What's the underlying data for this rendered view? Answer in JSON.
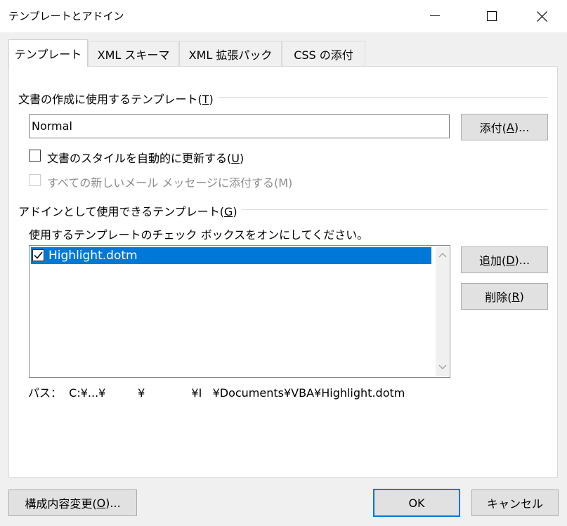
{
  "window": {
    "title": "テンプレートとアドイン"
  },
  "tabs": [
    {
      "label": "テンプレート",
      "active": true
    },
    {
      "label": "XML スキーマ",
      "active": false
    },
    {
      "label": "XML 拡張パック",
      "active": false
    },
    {
      "label": "CSS の添付",
      "active": false
    }
  ],
  "document_template": {
    "group_label": "文書の作成に使用するテンプレート(",
    "group_mnemonic": "T",
    "group_label_end": ")",
    "value": "Normal",
    "attach_button": "添付(",
    "attach_mnemonic": "A",
    "attach_end": ")...",
    "auto_update_label": "文書のスタイルを自動的に更新する(",
    "auto_update_mnemonic": "U",
    "auto_update_end": ")",
    "attach_all_mail_label": "すべての新しいメール メッセージに添付する(M)"
  },
  "global_templates": {
    "group_label": "アドインとして使用できるテンプレート(",
    "group_mnemonic": "G",
    "group_label_end": ")",
    "instruction": "使用するテンプレートのチェック ボックスをオンにしてください。",
    "items": [
      {
        "name": "Highlight.dotm",
        "checked": true,
        "selected": true
      }
    ],
    "add_button": "追加(",
    "add_mnemonic": "D",
    "add_end": ")...",
    "remove_button": "削除(",
    "remove_mnemonic": "R",
    "remove_end": ")",
    "path_text": "パス：  C:¥...¥         ¥             ¥I   ¥Documents¥VBA¥Highlight.dotm"
  },
  "footer": {
    "organizer_button": "構成内容変更(",
    "organizer_mnemonic": "O",
    "organizer_end": ")...",
    "ok_button": "OK",
    "cancel_button": "キャンセル"
  },
  "colors": {
    "accent": "#0078d7",
    "window_bg": "#f0f0f0",
    "panel_bg": "#ffffff",
    "button_bg": "#e1e1e1"
  }
}
